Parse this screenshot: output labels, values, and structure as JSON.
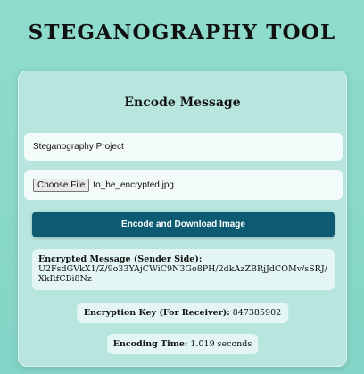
{
  "app_title": "STEGANOGRAPHY TOOL",
  "encode": {
    "heading": "Encode Message",
    "message_input_value": "Steganography Project",
    "file_button_label": "Choose File",
    "file_name": "to_be_encrypted.jpg",
    "encode_button_label": "Encode and Download Image"
  },
  "results": {
    "encrypted_label": "Encrypted Message (Sender Side):",
    "encrypted_value": "U2FsdGVkX1/Z/9o33YAjCWiC9N3Go8PH/2dkAzZBRjJdCOMv/sSRJ/XkRfCBi8Nz",
    "key_label": "Encryption Key (For Receiver):",
    "key_value": "847385902",
    "time_label": "Encoding Time:",
    "time_value": "1.019 seconds"
  },
  "colors": {
    "background": "#8fdccd",
    "card": "#b8e6df",
    "accent_button": "#0c5b72"
  }
}
